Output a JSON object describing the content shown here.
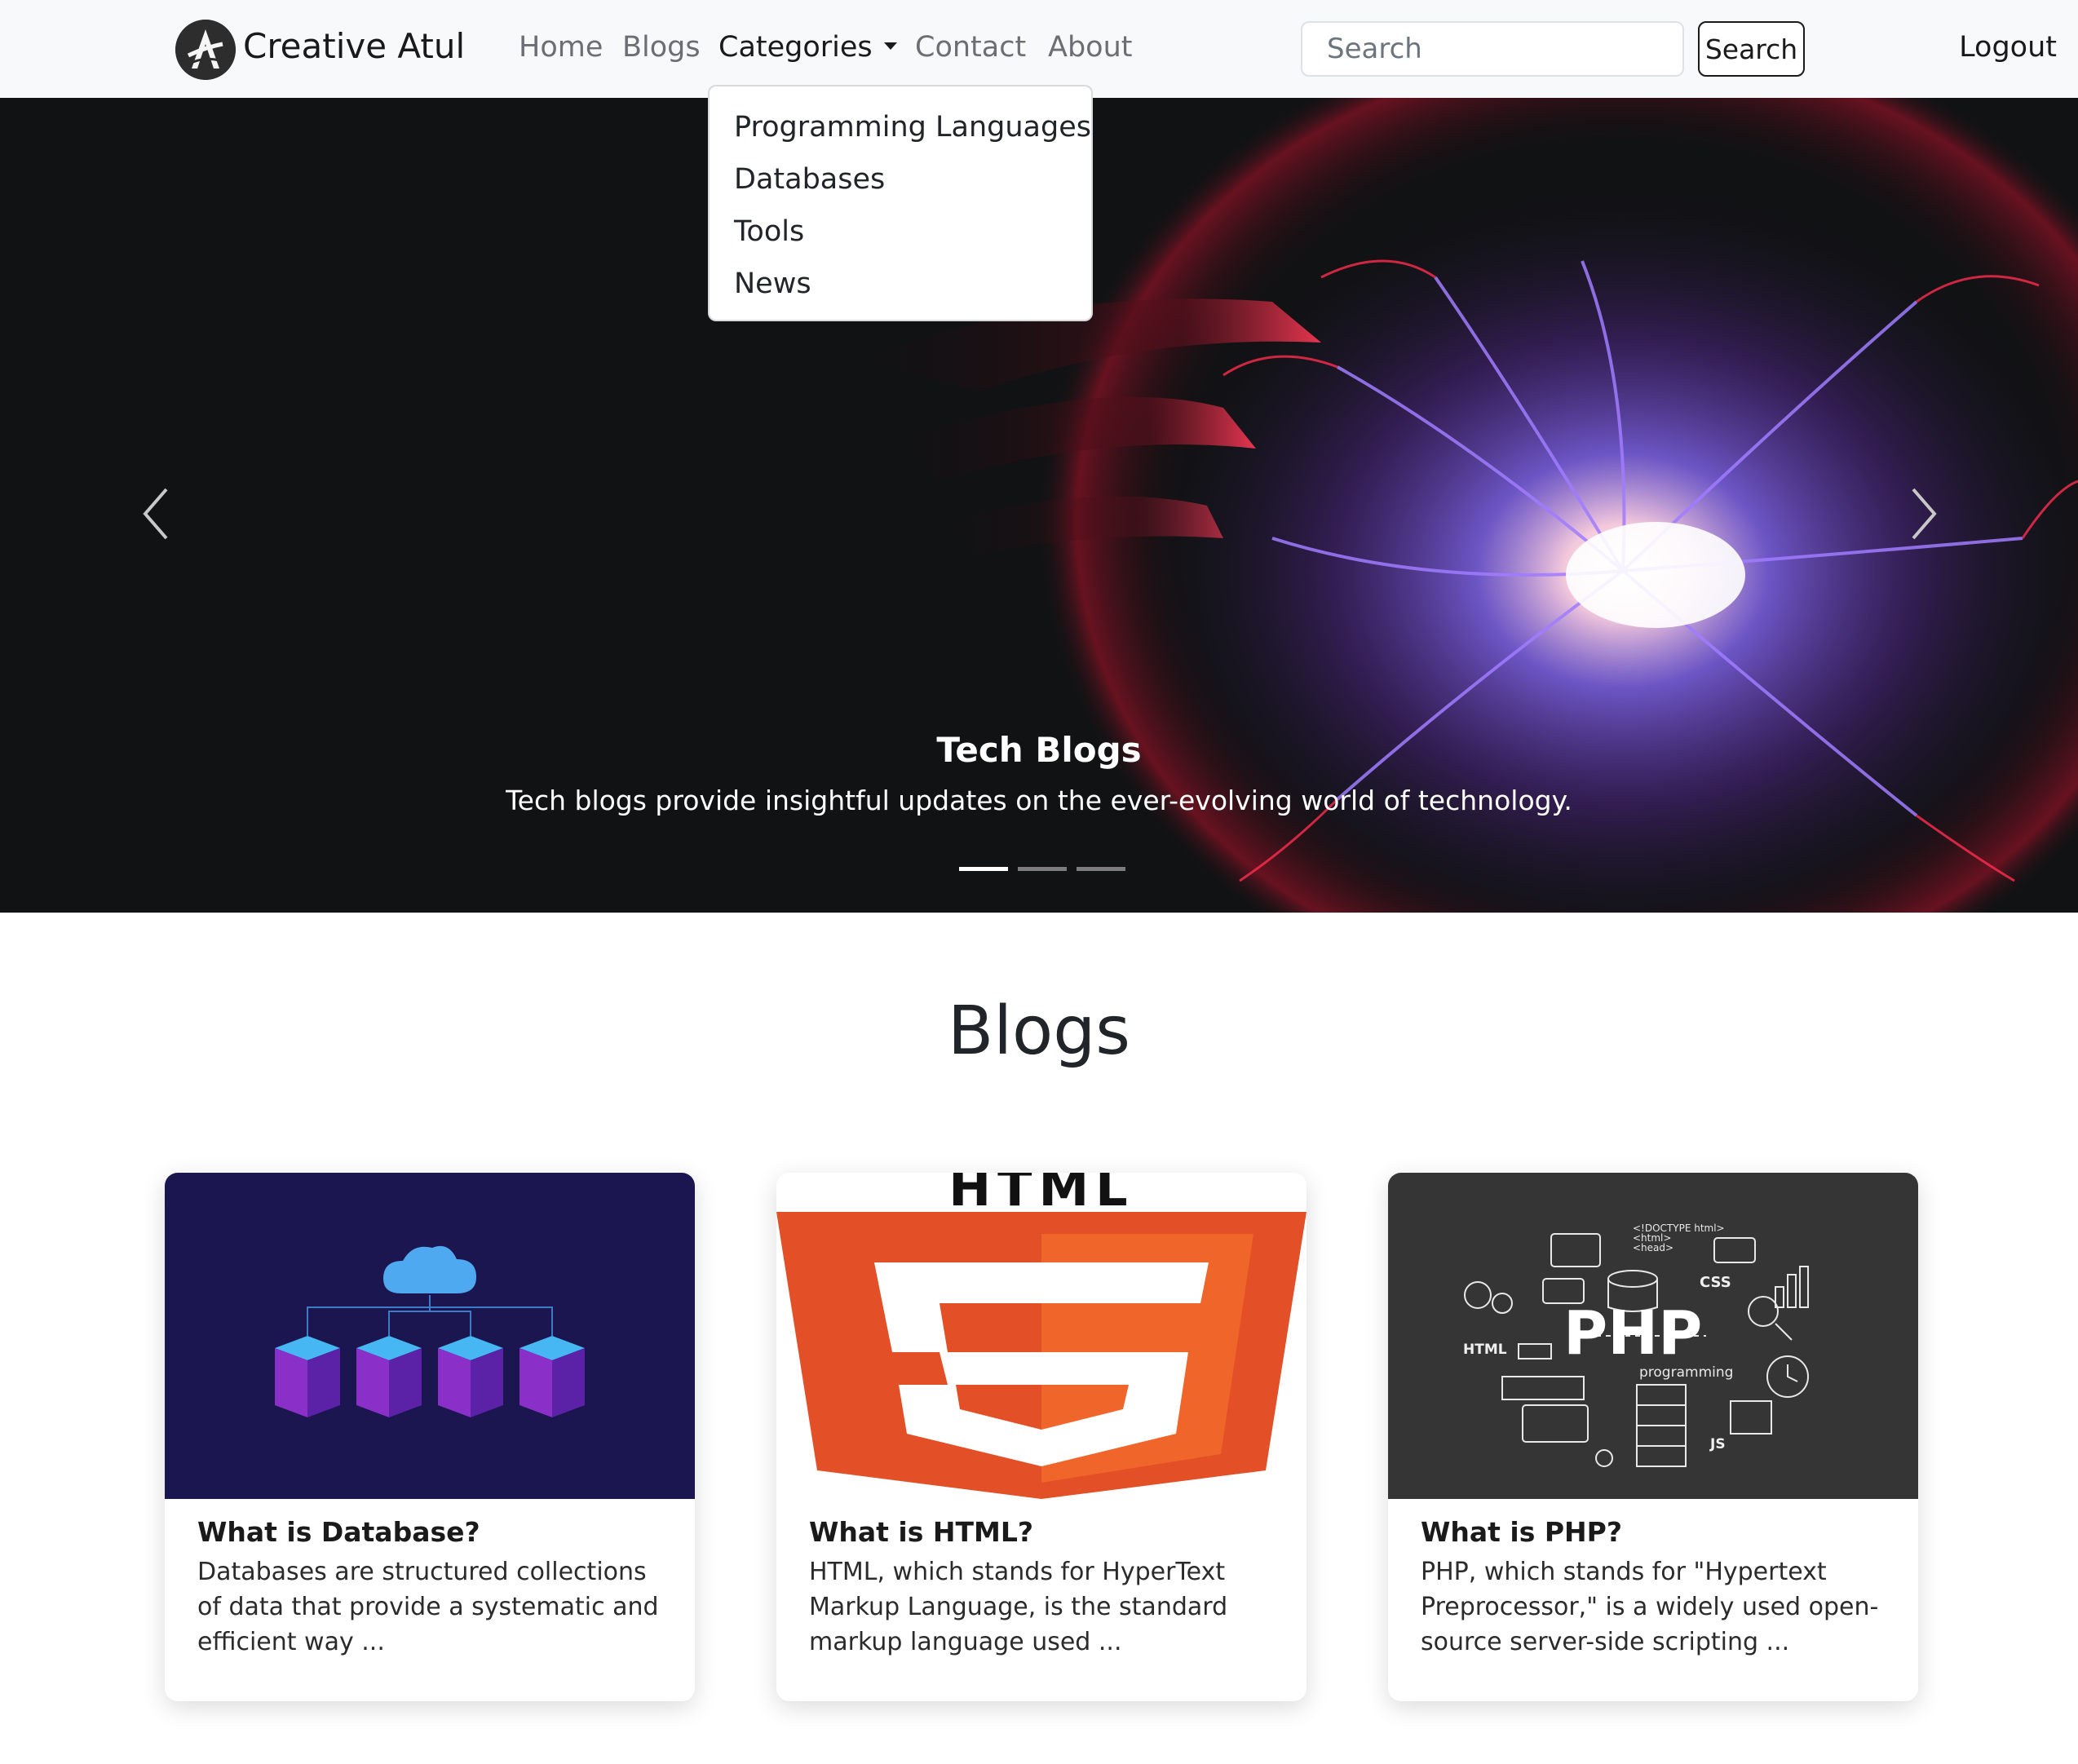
{
  "navbar": {
    "brand": "Creative Atul",
    "links": [
      {
        "label": "Home"
      },
      {
        "label": "Blogs"
      },
      {
        "label": "Categories"
      },
      {
        "label": "Contact"
      },
      {
        "label": "About"
      }
    ],
    "search_placeholder": "Search",
    "search_button": "Search",
    "logout": "Logout"
  },
  "dropdown": {
    "items": [
      {
        "label": "Programming Languages"
      },
      {
        "label": "Databases"
      },
      {
        "label": "Tools"
      },
      {
        "label": "News"
      }
    ]
  },
  "hero": {
    "title": "Tech Blogs",
    "text": "Tech blogs provide insightful updates on the ever-evolving world of technology.",
    "slides_count": 3,
    "active_slide": 1
  },
  "blogs": {
    "heading": "Blogs",
    "cards": [
      {
        "title": "What is Database?",
        "text": "Databases are structured collections of data that provide a systematic and efficient way ...",
        "image": "database-cloud-illustration"
      },
      {
        "title": "What is HTML?",
        "text": "HTML, which stands for HyperText Markup Language, is the standard markup language used ...",
        "image": "html5-logo",
        "image_text": "HTML"
      },
      {
        "title": "What is PHP?",
        "text": "PHP, which stands for \"Hypertext Preprocessor,\" is a widely used open-source server-side scripting ...",
        "image": "php-programming-illustration",
        "image_texts": {
          "doctype": "<!DOCTYPE html>",
          "html_tag": "<html>",
          "head_tag": "<head>",
          "css": "CSS",
          "php": "PHP",
          "html": "HTML",
          "programming": "programming",
          "js": "JS"
        }
      }
    ]
  },
  "colors": {
    "navbar_bg": "#f8f9fa",
    "hero_bg": "#111214",
    "html5_orange": "#e34f26",
    "html5_light": "#f06529",
    "db_bg": "#1b1650",
    "php_bg": "#353535"
  }
}
